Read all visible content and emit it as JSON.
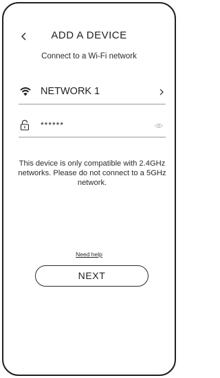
{
  "header": {
    "title": "ADD A DEVICE",
    "back_icon": "chevron-left-icon"
  },
  "subtitle": "Connect to a Wi-Fi network",
  "network": {
    "icon": "wifi-icon",
    "label": "NETWORK 1",
    "chevron_icon": "chevron-right-icon"
  },
  "password": {
    "icon": "lock-icon",
    "value": "******",
    "toggle_icon": "eye-icon"
  },
  "notice": "This device is only compatible with 2.4GHz networks. Please do not connect to a 5GHz network.",
  "help_link": "Need help",
  "next_button": "NEXT",
  "colors": {
    "text": "#1f1f1f",
    "border": "#1f1f1f",
    "divider": "#9a9a9a",
    "background": "#ffffff"
  }
}
